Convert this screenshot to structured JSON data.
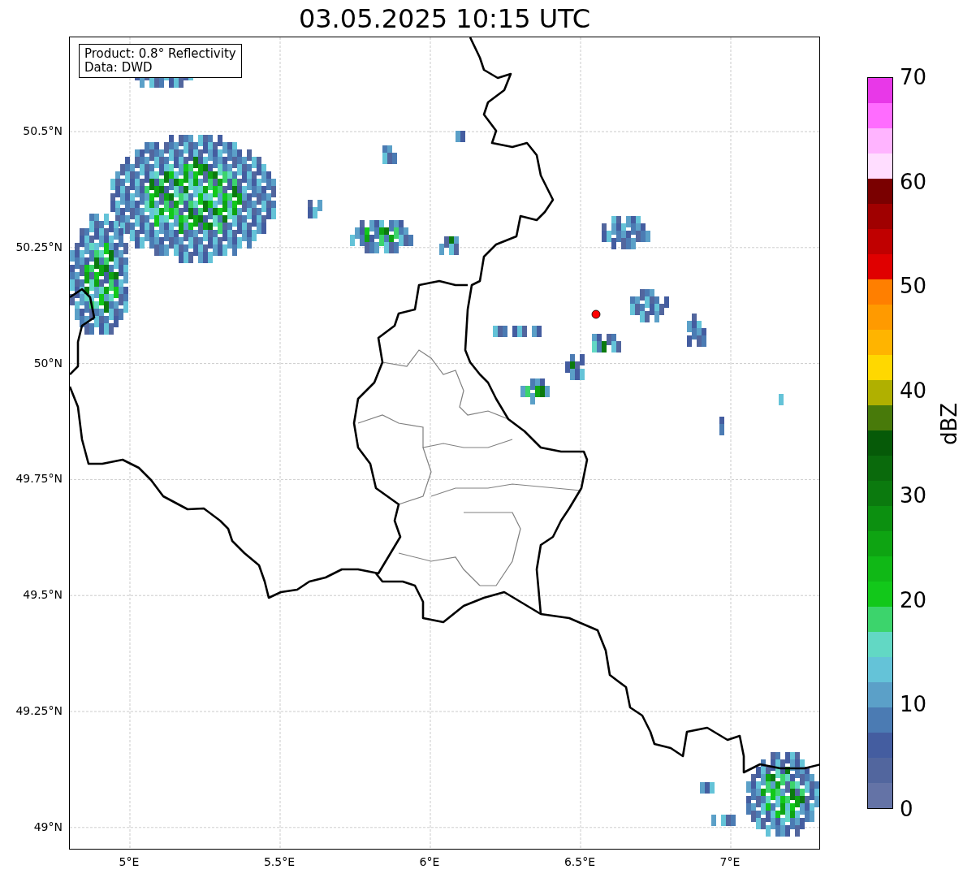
{
  "title": "03.05.2025 10:15 UTC",
  "info_box": [
    "Product: 0.8° Reflectivity",
    "Data: DWD"
  ],
  "map": {
    "x_ticks": [
      "5°E",
      "5.5°E",
      "6°E",
      "6.5°E",
      "7°E"
    ],
    "y_ticks": [
      "50.5°N",
      "50.25°N",
      "50°N",
      "49.75°N",
      "49.5°N",
      "49.25°N",
      "49°N"
    ]
  },
  "colorbar": {
    "label": "dBZ",
    "ticks": [
      "70",
      "60",
      "50",
      "40",
      "30",
      "20",
      "10",
      "0"
    ],
    "bands": [
      {
        "color": "#e838e8"
      },
      {
        "color": "#ff6cff"
      },
      {
        "color": "#ffb4ff"
      },
      {
        "color": "#ffddff"
      },
      {
        "color": "#7a0000"
      },
      {
        "color": "#a00000"
      },
      {
        "color": "#c00000"
      },
      {
        "color": "#e00000"
      },
      {
        "color": "#ff7f00"
      },
      {
        "color": "#ff9a00"
      },
      {
        "color": "#ffb400"
      },
      {
        "color": "#ffd800"
      },
      {
        "color": "#b0b000"
      },
      {
        "color": "#487a0a"
      },
      {
        "color": "#065a08"
      },
      {
        "color": "#0a6a0c"
      },
      {
        "color": "#0b7a0e"
      },
      {
        "color": "#0c9010"
      },
      {
        "color": "#0ea412"
      },
      {
        "color": "#10b816"
      },
      {
        "color": "#12c81a"
      },
      {
        "color": "#3cd46c"
      },
      {
        "color": "#62d8c4"
      },
      {
        "color": "#64c3d8"
      },
      {
        "color": "#5ba0c8"
      },
      {
        "color": "#4b7bb3"
      },
      {
        "color": "#445da0"
      },
      {
        "color": "#52669e"
      },
      {
        "color": "#6473a6"
      }
    ]
  }
}
